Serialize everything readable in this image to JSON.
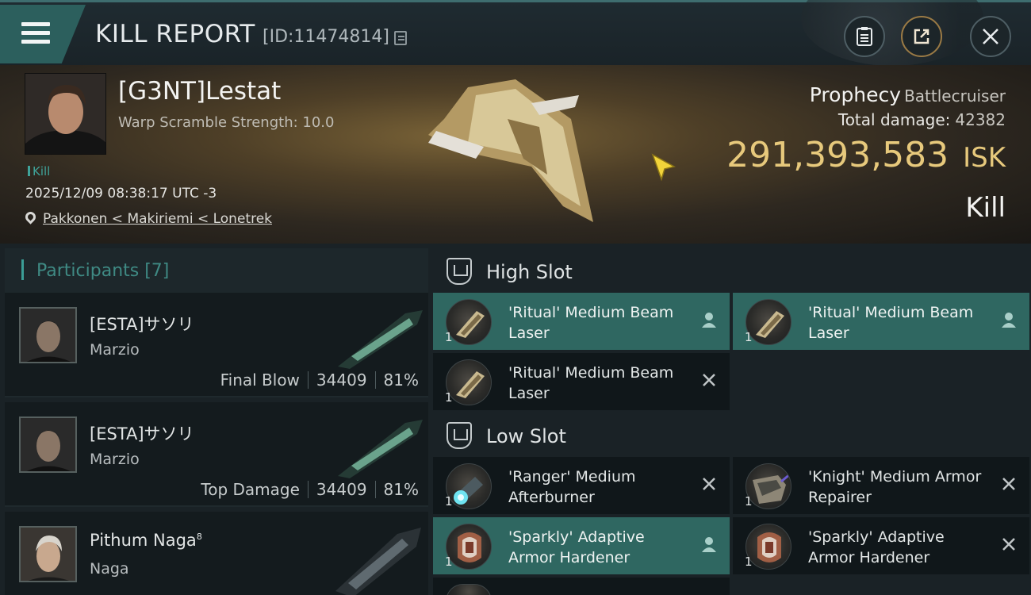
{
  "header": {
    "title": "KILL REPORT",
    "report_id": "[ID:11474814]"
  },
  "victim": {
    "pilot_name": "[G3NT]Lestat",
    "warp_scramble": "Warp Scramble Strength: 10.0",
    "tag": "Kill",
    "datetime": "2025/12/09 08:38:17 UTC -3",
    "location": "Pakkonen < Makiriemi < Lonetrek",
    "ship_name": "Prophecy",
    "ship_class": "Battlecruiser",
    "total_damage_label": "Total damage:",
    "total_damage": "42382",
    "isk_value": "291,393,583",
    "isk_unit": "ISK",
    "result": "Kill"
  },
  "participants": {
    "title": "Participants [7]",
    "list": [
      {
        "name": "[ESTA]サソリ",
        "ship": "Marzio",
        "role": "Final Blow",
        "damage": "34409",
        "percent": "81%"
      },
      {
        "name": "[ESTA]サソリ",
        "ship": "Marzio",
        "role": "Top Damage",
        "damage": "34409",
        "percent": "81%"
      },
      {
        "name": "Pithum Naga",
        "name_sup": "8",
        "ship": "Naga"
      }
    ]
  },
  "slots": {
    "high": {
      "title": "High Slot",
      "modules": [
        {
          "name": "'Ritual' Medium Beam Laser",
          "qty": "1",
          "status": "pilot"
        },
        {
          "name": "'Ritual' Medium Beam Laser",
          "qty": "1",
          "status": "pilot"
        },
        {
          "name": "'Ritual' Medium Beam Laser",
          "qty": "1",
          "status": "destroyed"
        }
      ]
    },
    "low": {
      "title": "Low Slot",
      "modules": [
        {
          "name": "'Ranger' Medium Afterburner",
          "qty": "1",
          "status": "destroyed"
        },
        {
          "name": "'Knight' Medium Armor Repairer",
          "qty": "1",
          "status": "destroyed"
        },
        {
          "name": "'Sparkly' Adaptive Armor Hardener",
          "qty": "1",
          "status": "pilot"
        },
        {
          "name": "'Sparkly' Adaptive Armor Hardener",
          "qty": "1",
          "status": "destroyed"
        }
      ]
    }
  },
  "icons": {
    "menu": "hamburger-menu-icon",
    "copy": "copy-icon",
    "clipboard": "clipboard-icon",
    "share": "share-icon",
    "close": "close-icon",
    "location": "location-pin-icon",
    "pilot_status": "person-icon",
    "destroyed_status": "x-icon"
  },
  "colors": {
    "accent_teal": "#2f6761",
    "isk_gold": "#e7c97c",
    "header_bg": "#1f2b31",
    "panel_bg": "#1a2226"
  }
}
